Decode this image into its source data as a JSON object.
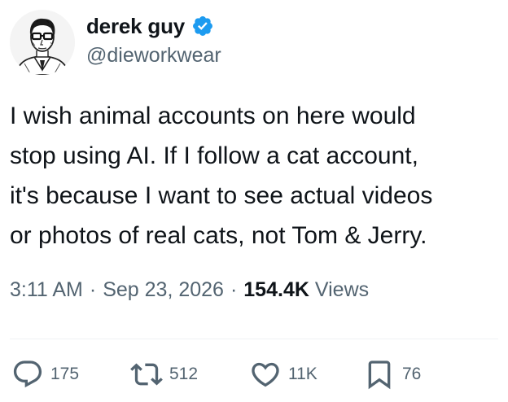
{
  "author": {
    "display_name": "derek guy",
    "handle": "@dieworkwear",
    "verified": true,
    "avatar_icon": "sketch-portrait-avatar"
  },
  "tweet": {
    "text": "I wish animal accounts on here would\nstop using AI. If I follow a cat account,\nit's because I want to see actual videos\nor photos of real cats, not Tom & Jerry."
  },
  "meta": {
    "time": "3:11 AM",
    "separator": "·",
    "date": "Sep 23, 2026",
    "views_count": "154.4K",
    "views_label": "Views"
  },
  "actions": {
    "replies": "175",
    "reposts": "512",
    "likes": "11K",
    "bookmarks": "76"
  },
  "colors": {
    "verified_blue": "#1d9bf0",
    "text_primary": "#0f1419",
    "text_secondary": "#536471",
    "divider": "#eff3f4"
  }
}
